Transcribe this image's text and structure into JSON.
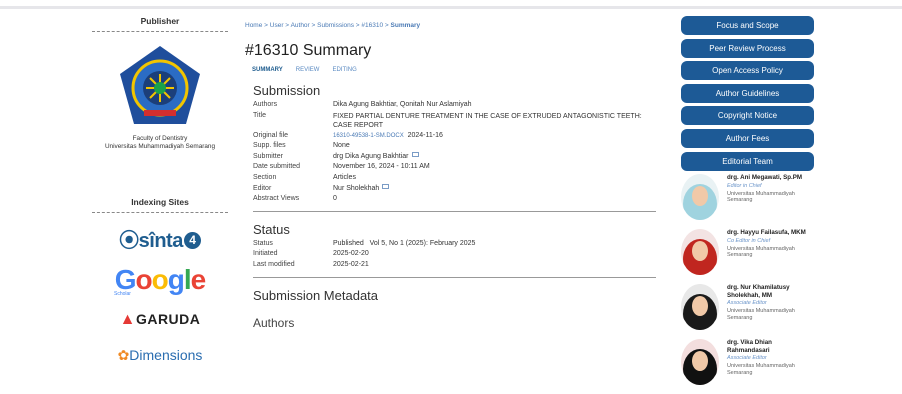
{
  "publisher": {
    "heading": "Publisher",
    "faculty_line1": "Faculty of Dentistry",
    "faculty_line2": "Universitas Muhammadiyah Semarang"
  },
  "indexing": {
    "heading": "Indexing Sites",
    "sinta": "sînta",
    "sinta_level": "4",
    "google": [
      "G",
      "o",
      "o",
      "g",
      "l",
      "e"
    ],
    "google_sub": "Scholar",
    "garuda": "GARUDA",
    "dimensions": "Dimensions"
  },
  "breadcrumb": {
    "home": "Home",
    "user": "User",
    "author": "Author",
    "submissions": "Submissions",
    "id": "#16310",
    "current": "Summary",
    "sep": " > "
  },
  "page_title": "#16310 Summary",
  "tabs": {
    "summary": "SUMMARY",
    "review": "REVIEW",
    "editing": "EDITING"
  },
  "submission": {
    "heading": "Submission",
    "authors_label": "Authors",
    "authors": "Dika Agung Bakhtiar, Qonitah Nur Aslamiyah",
    "title_label": "Title",
    "title": "FIXED PARTIAL DENTURE TREATMENT IN THE CASE OF EXTRUDED ANTAGONISTIC TEETH: CASE REPORT",
    "original_file_label": "Original file",
    "original_file": "16310-49538-1-SM.DOCX",
    "original_file_date": "2024-11-16",
    "supp_label": "Supp. files",
    "supp": "None",
    "submitter_label": "Submitter",
    "submitter": "drg Dika Agung Bakhtiar",
    "date_label": "Date submitted",
    "date": "November 16, 2024 - 10:11 AM",
    "section_label": "Section",
    "section": "Articles",
    "editor_label": "Editor",
    "editor": "Nur Sholekhah",
    "abstract_label": "Abstract Views",
    "abstract": "0"
  },
  "status": {
    "heading": "Status",
    "status_label": "Status",
    "status": "Published",
    "issue": "Vol 5, No 1 (2025): February 2025",
    "initiated_label": "Initiated",
    "initiated": "2025-02-20",
    "modified_label": "Last modified",
    "modified": "2025-02-21"
  },
  "metadata": {
    "heading": "Submission Metadata",
    "authors_heading": "Authors"
  },
  "nav_buttons": [
    "Focus and Scope",
    "Peer Review Process",
    "Open Access Policy",
    "Author Guidelines",
    "Copyright Notice",
    "Author Fees",
    "Editorial Team"
  ],
  "editors": [
    {
      "name": "drg. Ani Megawati, Sp.PM",
      "role": "Editor in Chief",
      "affil": "Universitas Muhammadiyah Semarang",
      "hijab": "#9fd3df"
    },
    {
      "name": "drg. Hayyu Failasufa, MKM",
      "role": "Co Editor in Chief",
      "affil": "Universitas Muhammadiyah Semarang",
      "hijab": "#c0261f"
    },
    {
      "name": "drg. Nur Khamilatusy Sholekhah, MM",
      "role": "Associate Editor",
      "affil": "Universitas Muhammadiyah Semarang",
      "hijab": "#1a1a1a"
    },
    {
      "name": "drg. Vika Dhian Rahmandasari",
      "role": "Associate Editor",
      "affil": "Universitas Muhammadiyah Semarang",
      "hijab": "#111111"
    }
  ],
  "colors": {
    "accent": "#1d5a96",
    "link": "#4a7ab5"
  }
}
